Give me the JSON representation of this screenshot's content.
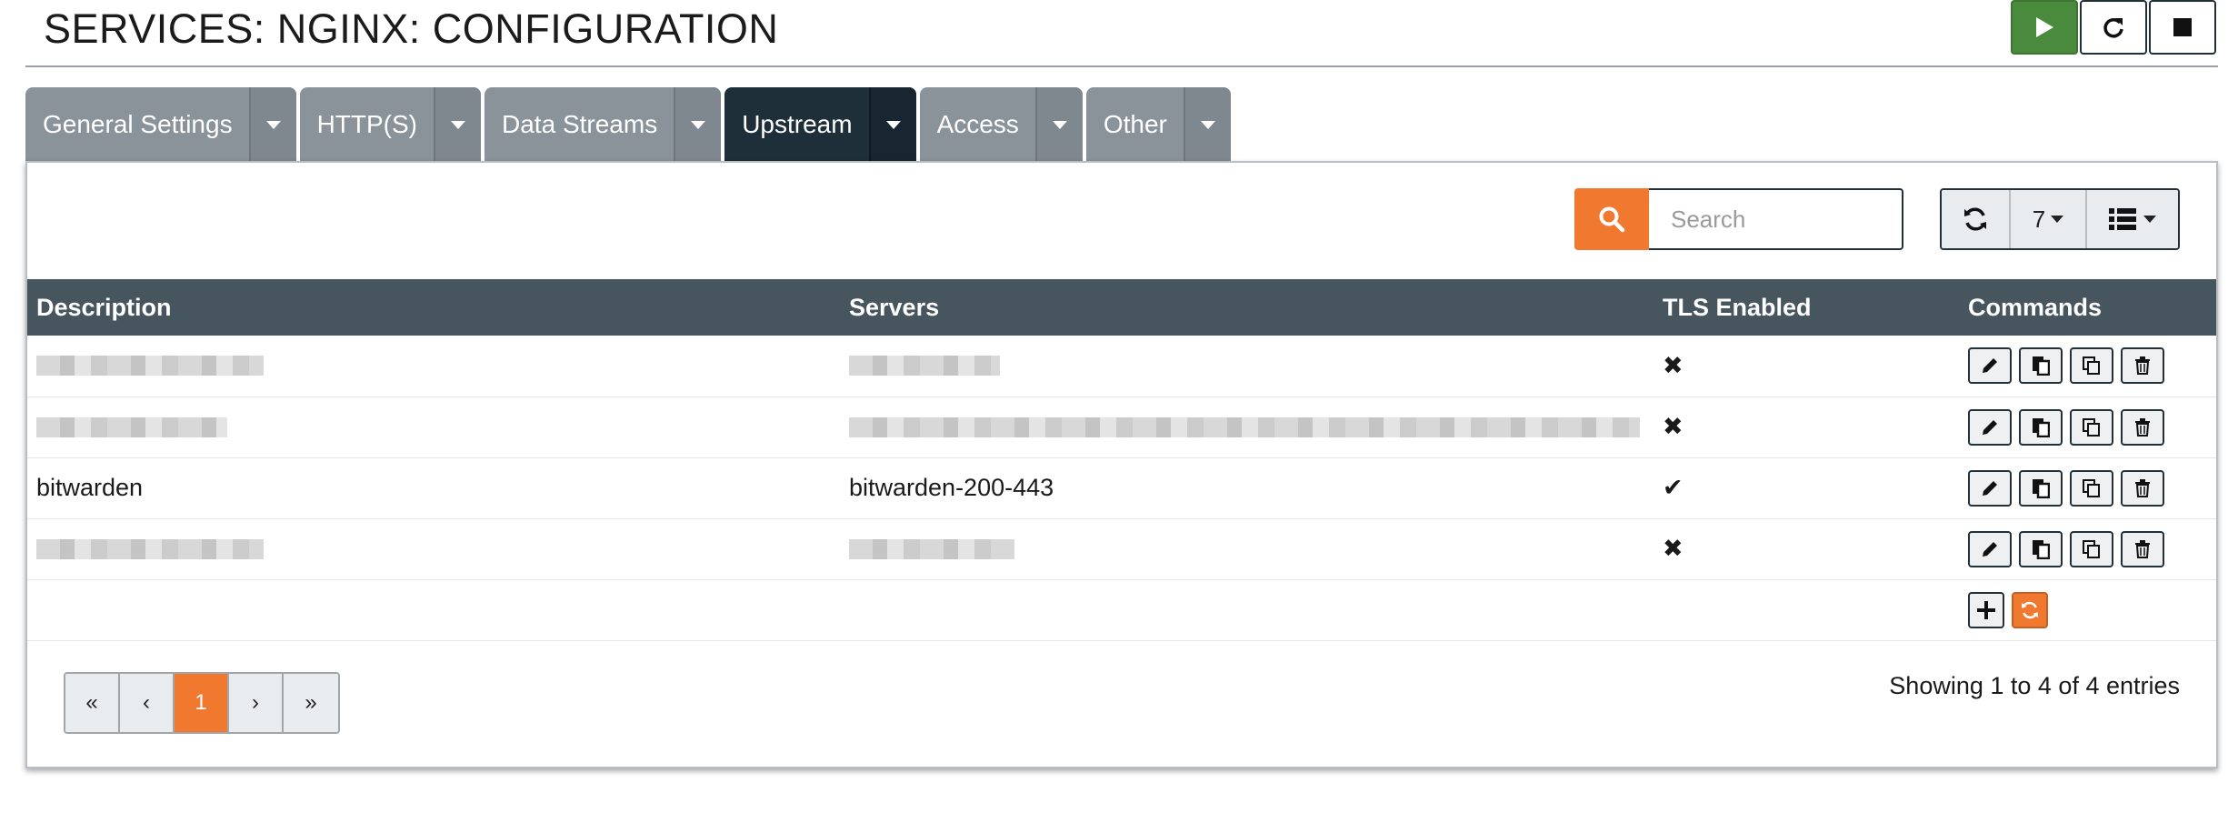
{
  "header": {
    "title": "SERVICES: NGINX: CONFIGURATION"
  },
  "service_controls": {
    "start": "play-icon",
    "restart": "restart-icon",
    "stop": "stop-icon",
    "start_color": "#4a8a3d"
  },
  "tabs": [
    {
      "label": "General Settings",
      "active": false
    },
    {
      "label": "HTTP(S)",
      "active": false
    },
    {
      "label": "Data Streams",
      "active": false
    },
    {
      "label": "Upstream",
      "active": true
    },
    {
      "label": "Access",
      "active": false
    },
    {
      "label": "Other",
      "active": false
    }
  ],
  "toolbar": {
    "search_placeholder": "Search",
    "rows_per_page": "7"
  },
  "table": {
    "headers": {
      "description": "Description",
      "servers": "Servers",
      "tls": "TLS Enabled",
      "commands": "Commands"
    },
    "rows": [
      {
        "description": "",
        "servers": "",
        "tls": "✖",
        "description_redacted": true,
        "servers_redacted": true
      },
      {
        "description": "",
        "servers": "",
        "tls": "✖",
        "description_redacted": true,
        "servers_redacted": true
      },
      {
        "description": "bitwarden",
        "servers": "bitwarden-200-443",
        "tls": "✔",
        "description_redacted": false,
        "servers_redacted": false
      },
      {
        "description": "",
        "servers": "",
        "tls": "✖",
        "description_redacted": true,
        "servers_redacted": true
      }
    ]
  },
  "pagination": {
    "first": "«",
    "prev": "‹",
    "current": "1",
    "next": "›",
    "last": "»"
  },
  "footer": {
    "entries_text": "Showing 1 to 4 of 4 entries"
  },
  "colors": {
    "accent": "#f0782f",
    "header_bg": "#47555f",
    "active_tab": "#1e2f3a"
  }
}
